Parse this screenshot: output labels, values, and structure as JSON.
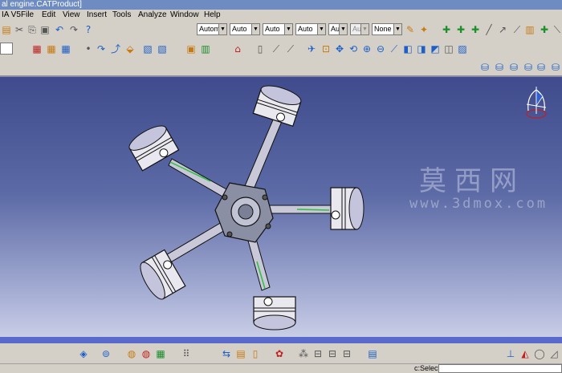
{
  "window": {
    "title": "al engine.CATProduct]"
  },
  "menu": {
    "app": "IA V5",
    "items": [
      "File",
      "Edit",
      "View",
      "Insert",
      "Tools",
      "Analyze",
      "Window",
      "Help"
    ]
  },
  "toolbar": {
    "combos": [
      {
        "value": "Autom",
        "disabled": false
      },
      {
        "value": "Auto",
        "disabled": false
      },
      {
        "value": "Auto",
        "disabled": false
      },
      {
        "value": "Auto",
        "disabled": false
      },
      {
        "value": "Aut",
        "disabled": false
      },
      {
        "value": "Aut",
        "disabled": true
      },
      {
        "value": "None",
        "disabled": false
      }
    ]
  },
  "watermark": {
    "cn": "莫西网",
    "url": "www.3dmox.com"
  },
  "status": {
    "text": "c:Select"
  },
  "colors": {
    "viewport_top": "#3f4b8c",
    "viewport_bottom": "#c9cde6",
    "accent_bar": "#5a6acc",
    "titlebar": "#6f8cc2"
  }
}
